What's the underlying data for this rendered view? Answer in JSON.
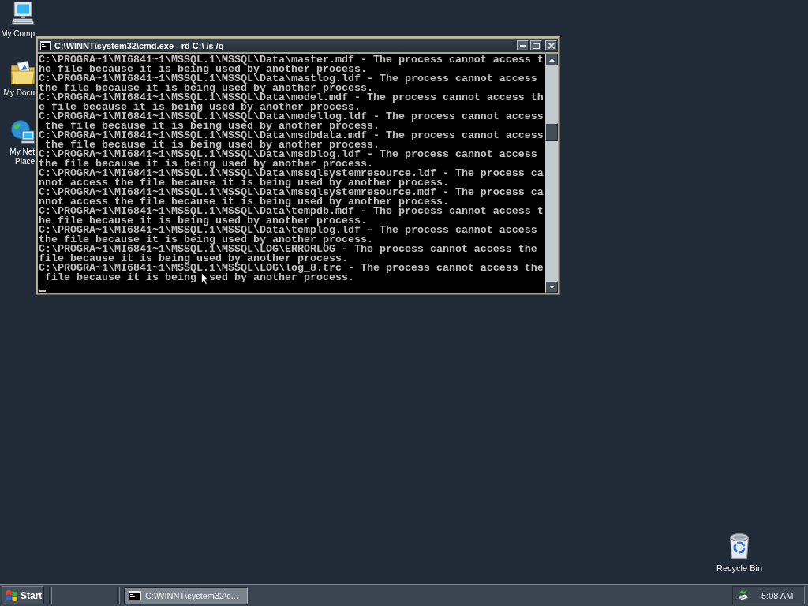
{
  "desktop_icons": [
    {
      "kind": "computer",
      "label_lines": [
        "My Comp"
      ]
    },
    {
      "kind": "documents",
      "label_lines": [
        "My Docu"
      ]
    },
    {
      "kind": "network",
      "label_lines": [
        "My Net",
        "Place"
      ]
    }
  ],
  "console_window": {
    "title": "C:\\WINNT\\system32\\cmd.exe - rd C:\\ /s /q",
    "lines": [
      [
        "C:\\PROGRA~1\\MI6841~1\\MSSQL.1\\MSSQL\\Data\\master.mdf - The process cannot access t"
      ],
      [
        "he file because it is being used by another process."
      ],
      [
        "C:\\PROGRA~1\\MI6841~1\\MSSQL.1\\MSSQL\\Data\\mastlog.ldf - The process cannot access"
      ],
      [
        "the file because it is being used by another process."
      ],
      [
        "C:\\PROGRA~1\\MI6841~1\\MSSQL.1\\MSSQL\\Data\\model.mdf - The process cannot access th"
      ],
      [
        "e file because it is being used by another process."
      ],
      [
        "C:\\PROGRA~1\\MI6841~1\\MSSQL.1\\MSSQL\\Data\\modellog.ldf - The process cannot access"
      ],
      [
        " the file because it is being used by another process."
      ],
      [
        "C:\\PROGRA~1\\MI6841~1\\MSSQL.1\\MSSQL\\Data\\msdbdata.mdf - The process cannot access"
      ],
      [
        " the file because it is being used by another process."
      ],
      [
        "C:\\PROGRA~1\\MI6841~1\\MSSQL.1\\MSSQL\\Data\\msdblog.ldf - The process cannot access"
      ],
      [
        "the file because it is being used by another process."
      ],
      [
        "C:\\PROGRA~1\\MI6841~1\\MSSQL.1\\MSSQL\\Data\\mssqlsystemresource.ldf - The process ca"
      ],
      [
        "nnot access the file because it is being used by another process."
      ],
      [
        "C:\\PROGRA~1\\MI6841~1\\MSSQL.1\\MSSQL\\Data\\mssqlsystemresource.mdf - The process ca"
      ],
      [
        "nnot access the file because it is being used by another process."
      ],
      [
        "C:\\PROGRA~1\\MI6841~1\\MSSQL.1\\MSSQL\\Data\\tempdb.mdf - The process cannot access t"
      ],
      [
        "he file because it is being used by another process."
      ],
      [
        "C:\\PROGRA~1\\MI6841~1\\MSSQL.1\\MSSQL\\Data\\templog.ldf - The process cannot access"
      ],
      [
        "the file because it is being used by another process."
      ],
      [
        "C:\\PROGRA~1\\MI6841~1\\MSSQL.1\\MSSQL\\LOG\\ERRORLOG - The process cannot access the"
      ],
      [
        "file because it is being used by another process."
      ],
      [
        "C:\\PROGRA~1\\MI6841~1\\MSSQL.1\\MSSQL\\LOG\\log_8.trc - The process cannot access the"
      ],
      [
        " file because it is being",
        "sed by another process."
      ]
    ]
  },
  "recycle_bin": {
    "label": "Recycle Bin"
  },
  "taskbar": {
    "start_button": "Start",
    "tasks": [
      {
        "label": "C:\\WINNT\\system32\\c...",
        "selected": true
      }
    ],
    "clock": "5:08 AM"
  }
}
